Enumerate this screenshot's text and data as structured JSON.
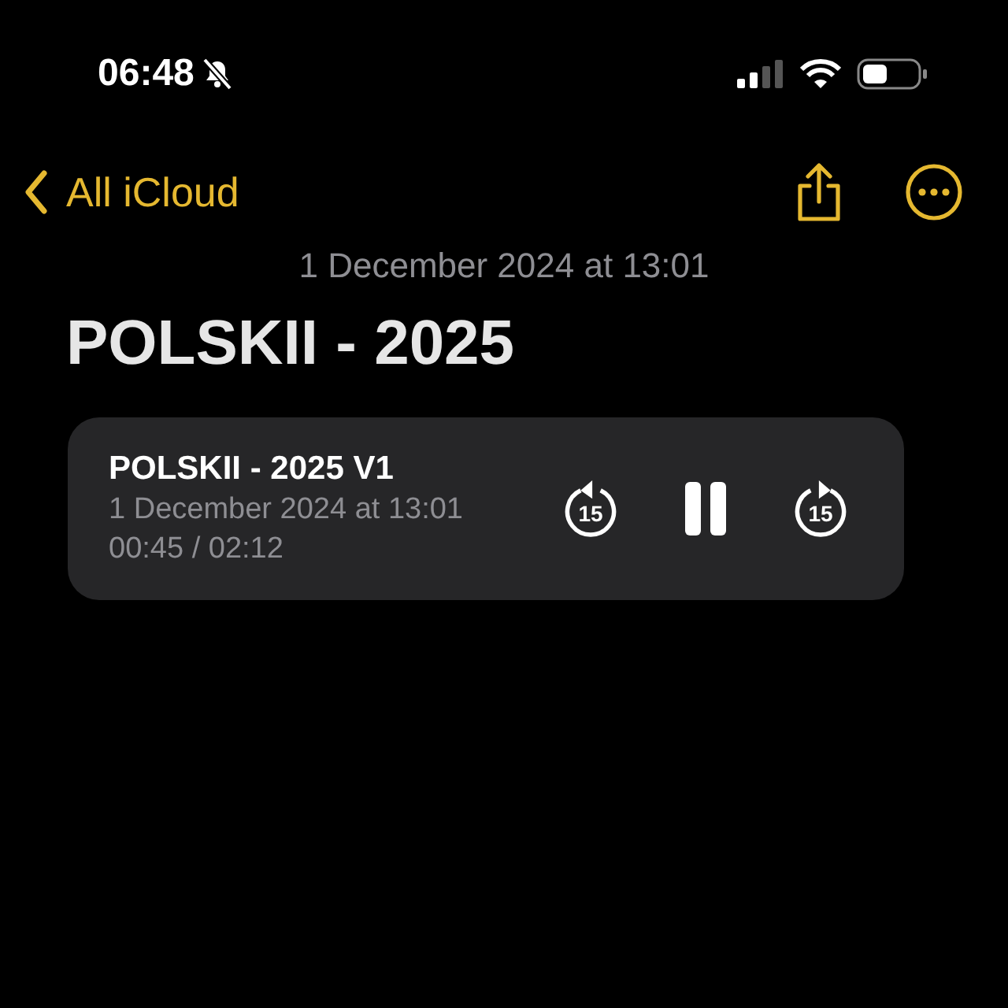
{
  "status_bar": {
    "time": "06:48",
    "silent": true
  },
  "nav": {
    "back_label": "All iCloud"
  },
  "note": {
    "date": "1 December 2024 at 13:01",
    "title": "POLSKII - 2025"
  },
  "recording": {
    "title": "POLSKII - 2025 V1",
    "date": "1 December 2024 at 13:01",
    "progress": "00:45 / 02:12",
    "playing": true,
    "skip_back": "15",
    "skip_forward": "15"
  }
}
